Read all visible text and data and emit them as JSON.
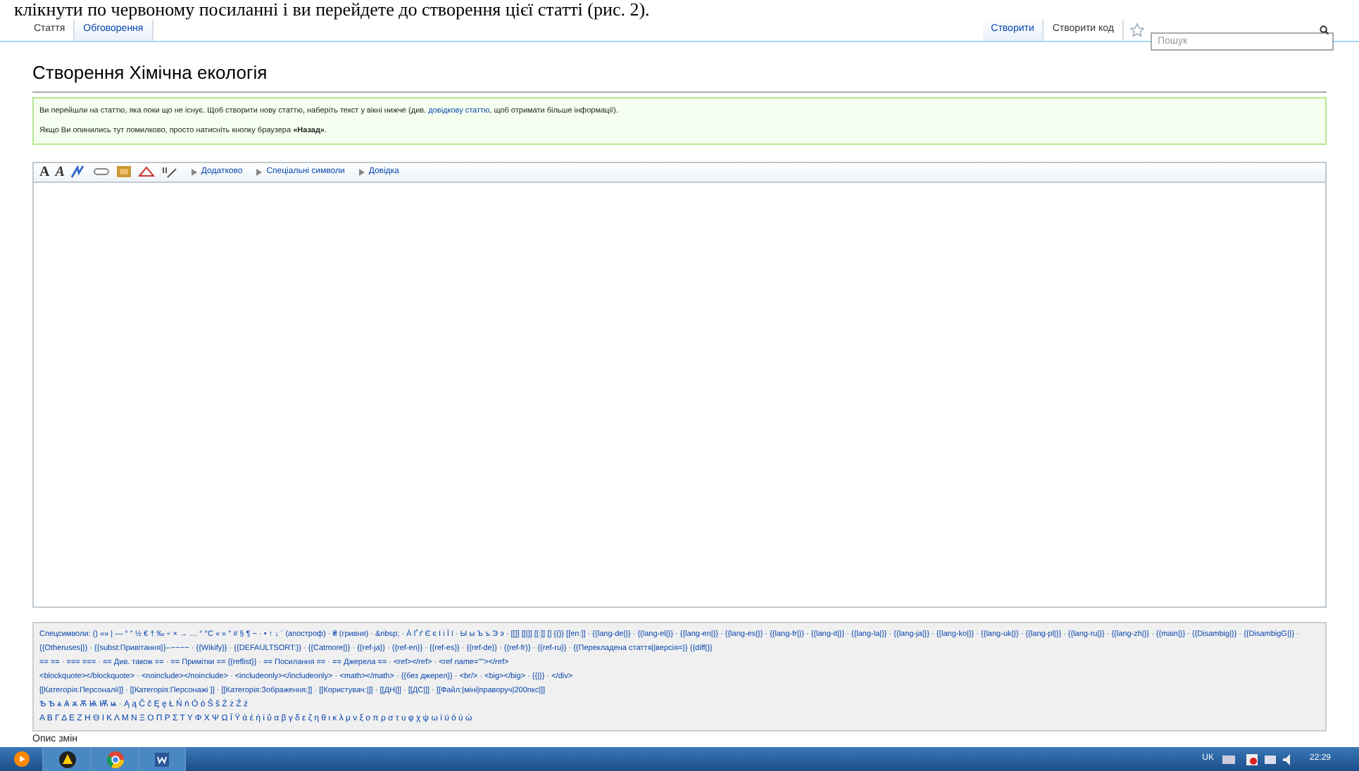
{
  "document_text": "клікнути по червоному посиланні і ви перейдете до створення цієї статті (рис. 2).",
  "tabs_left": [
    {
      "label": "Стаття",
      "selected": true
    },
    {
      "label": "Обговорення",
      "selected": false
    }
  ],
  "tabs_right": [
    {
      "label": "Створити",
      "selected": false
    },
    {
      "label": "Створити код",
      "selected": true
    }
  ],
  "search": {
    "placeholder": "Пошук"
  },
  "heading": "Створення Хімічна екологія",
  "notice": {
    "line1_before": "Ви перейшли на статтю, яка поки що не існує. Щоб створити нову статтю, наберіть текст у вікні нижче (див.",
    "link": "довідкову статтю",
    "line1_after": ", щоб отримати більше інформації).",
    "line2": "Якщо Ви опинились тут помилково, просто натисніть кнопку браузера **«Назад»**."
  },
  "toolbar": {
    "bold": "A",
    "italic": "A",
    "menus": [
      "Додатково",
      "Спеціальні символи",
      "Довідка"
    ]
  },
  "special_chars": [
    "Спецсимволи: () «» | — ° ″ ½ € † ‰ ÷ × → … ° °C « » ″ # § ¶ ~ · • ↑ ↓ ´ (апостроф) · ₴ (гривня) · &nbsp; · Ā Ґ ґ Є є І і Ї ї · Ы ы Ъ ъ Э э · [[]] [[|]] [[:]] [] {{}} [[en:]] · {{lang-de|}} · {{lang-el|}} · {{lang-en|}} · {{lang-es|}} · {{lang-fr|}} · {{lang-it|}} · {{lang-la|}} · {{lang-ja|}} · {{lang-ko|}} · {{lang-uk|}} · {{lang-pl|}} · {{lang-ru|}} · {{lang-zh|}} · {{main|}} · {{Disambig|}} · {{DisambigG|}} · {{Otheruses|}} · {{subst:Привітання}}--~~~~ · {{Wikify}} · {{DEFAULTSORT:}} · {{Catmore|}} · {{ref-ja}} · {{ref-en}} · {{ref-es}} · {{ref-de}} · {{ref-fr}} · {{ref-ru}} · {{Перекладена стаття||версія=}} {{diff|}}",
    "== == · === === · == Див. також == · == Примітки == {{reflist}} · == Посилання == · == Джерела == · <ref></ref> · <ref name=\"\"></ref>",
    "<blockquote></blockquote> · <noinclude></noinclude> · <includeonly></includeonly> · <math></math> · {{без джерел}} · <br/> · <big></big> · {{|}} · </div>",
    "[[Категорія:Персоналії]] · [[Категорія:Персонажі ]] · [[Категорія:Зображення:]] · [[Користувач:|]] · [[ДН|]] · [[ДС|]] · [[Файл:|міні|праворуч|200пкс|]]",
    "Ѣ Ѣ ѧ Ѧ ѫ Ѫ Ѩ Ѭ ѩ · Ą ą Č č Ę ę Ł Ń ń Ó ó Š š Ż ż Ź ź",
    "Α Β Γ Δ Ε Ζ Η Θ Ι Κ Λ Μ Ν Ξ Ο Π Ρ Σ Τ Υ Φ Χ Ψ Ω Ϊ Ϋ ά έ ή ί ΰ α β γ δ ε ζ η θ ι κ λ μ ν ξ ο π ρ σ τ υ φ χ ψ ω ϊ ϋ ό ύ ώ"
  ],
  "summary_label": "Опис змін",
  "taskbar": {
    "language": "UK",
    "time": "22:29"
  }
}
